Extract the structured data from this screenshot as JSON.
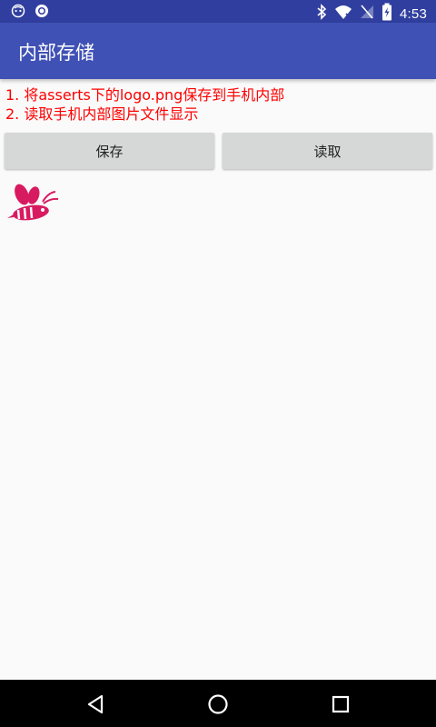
{
  "status_bar": {
    "time": "4:53",
    "left_icons": [
      "notification-face-icon",
      "circle-notification-icon"
    ],
    "right_icons": [
      "bluetooth-icon",
      "wifi-icon",
      "no-signal-icon",
      "battery-charging-icon"
    ]
  },
  "app_bar": {
    "title": "内部存储"
  },
  "instructions": [
    "1. 将asserts下的logo.png保存到手机内部",
    "2. 读取手机内部图片文件显示"
  ],
  "buttons": {
    "save_label": "保存",
    "read_label": "读取"
  },
  "image": {
    "icon": "bee-logo-icon"
  },
  "nav_bar": {
    "icons": [
      "back-icon",
      "home-icon",
      "recents-icon"
    ]
  },
  "colors": {
    "status_bar": "#303f9f",
    "app_bar": "#3f51b5",
    "instruction_text": "#ff0000",
    "button_bg": "#d6d7d7",
    "logo": "#d81b60"
  }
}
